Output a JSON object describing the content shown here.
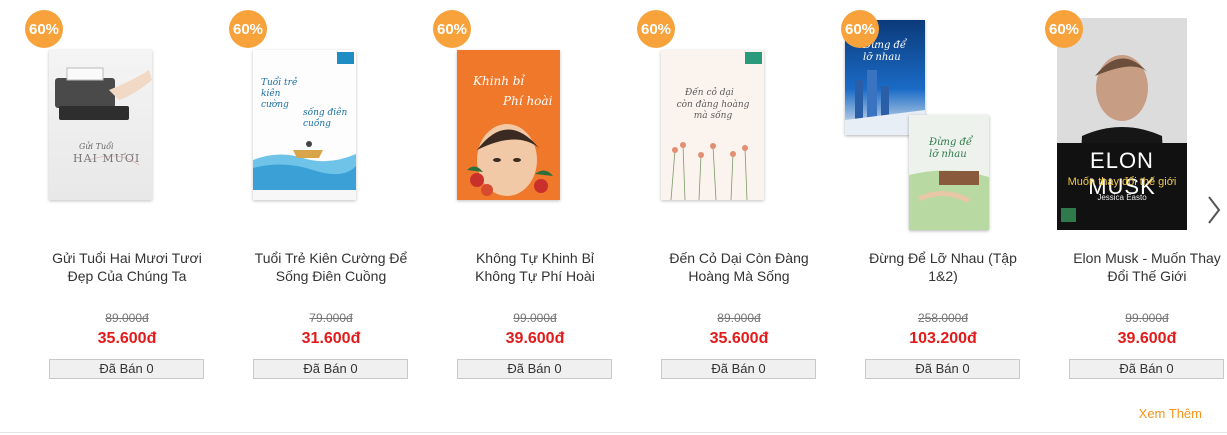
{
  "products": [
    {
      "discount": "60%",
      "title_line1": "Gửi Tuổi Hai Mươi Tươi",
      "title_line2": "Đẹp Của Chúng Ta",
      "old_price": "89.000đ",
      "new_price": "35.600đ",
      "sold": "Đã Bán 0",
      "cover": {
        "line1": "Gửi Tuổi",
        "line2": "HAI MƯƠI"
      }
    },
    {
      "discount": "60%",
      "title_line1": "Tuổi Trẻ Kiên Cường Để",
      "title_line2": "Sống Điên Cuồng",
      "old_price": "79.000đ",
      "new_price": "31.600đ",
      "sold": "Đã Bán 0",
      "cover": {
        "line1": "Tuổi trẻ kiên cường",
        "line2": "sống điên cuồng"
      }
    },
    {
      "discount": "60%",
      "title_line1": "Không Tự Khinh Bỉ",
      "title_line2": "Không Tự Phí Hoài",
      "old_price": "99.000đ",
      "new_price": "39.600đ",
      "sold": "Đã Bán 0",
      "cover": {
        "line1": "Khinh bỉ",
        "line2": "Phí hoài"
      }
    },
    {
      "discount": "60%",
      "title_line1": "Đến Cỏ Dại Còn Đàng",
      "title_line2": "Hoàng Mà Sống",
      "old_price": "89.000đ",
      "new_price": "35.600đ",
      "sold": "Đã Bán 0",
      "cover": {
        "line1": "Đến cỏ dại",
        "line2": "còn đàng hoàng mà sống"
      }
    },
    {
      "discount": "60%",
      "title_line1": "Đừng Để Lỡ Nhau (Tập",
      "title_line2": "1&2)",
      "old_price": "258.000đ",
      "new_price": "103.200đ",
      "sold": "Đã Bán 0",
      "cover": {
        "line1": "Đừng để lỡ nhau",
        "line2": "Đừng để lỡ nhau"
      }
    },
    {
      "discount": "60%",
      "title_line1": "Elon Musk - Muốn Thay",
      "title_line2": "Đổi Thế Giới",
      "old_price": "99.000đ",
      "new_price": "39.600đ",
      "sold": "Đã Bán 0",
      "cover": {
        "line1": "ELON MUSK",
        "line2": "Muốn thay đổi thế giới",
        "author": "Jessica Easto"
      }
    }
  ],
  "more_link": "Xem Thêm",
  "icons": {
    "next": "chevron-right-icon"
  },
  "colors": {
    "badge": "#f7a23b",
    "price": "#e11b1b",
    "more": "#f7941d"
  }
}
